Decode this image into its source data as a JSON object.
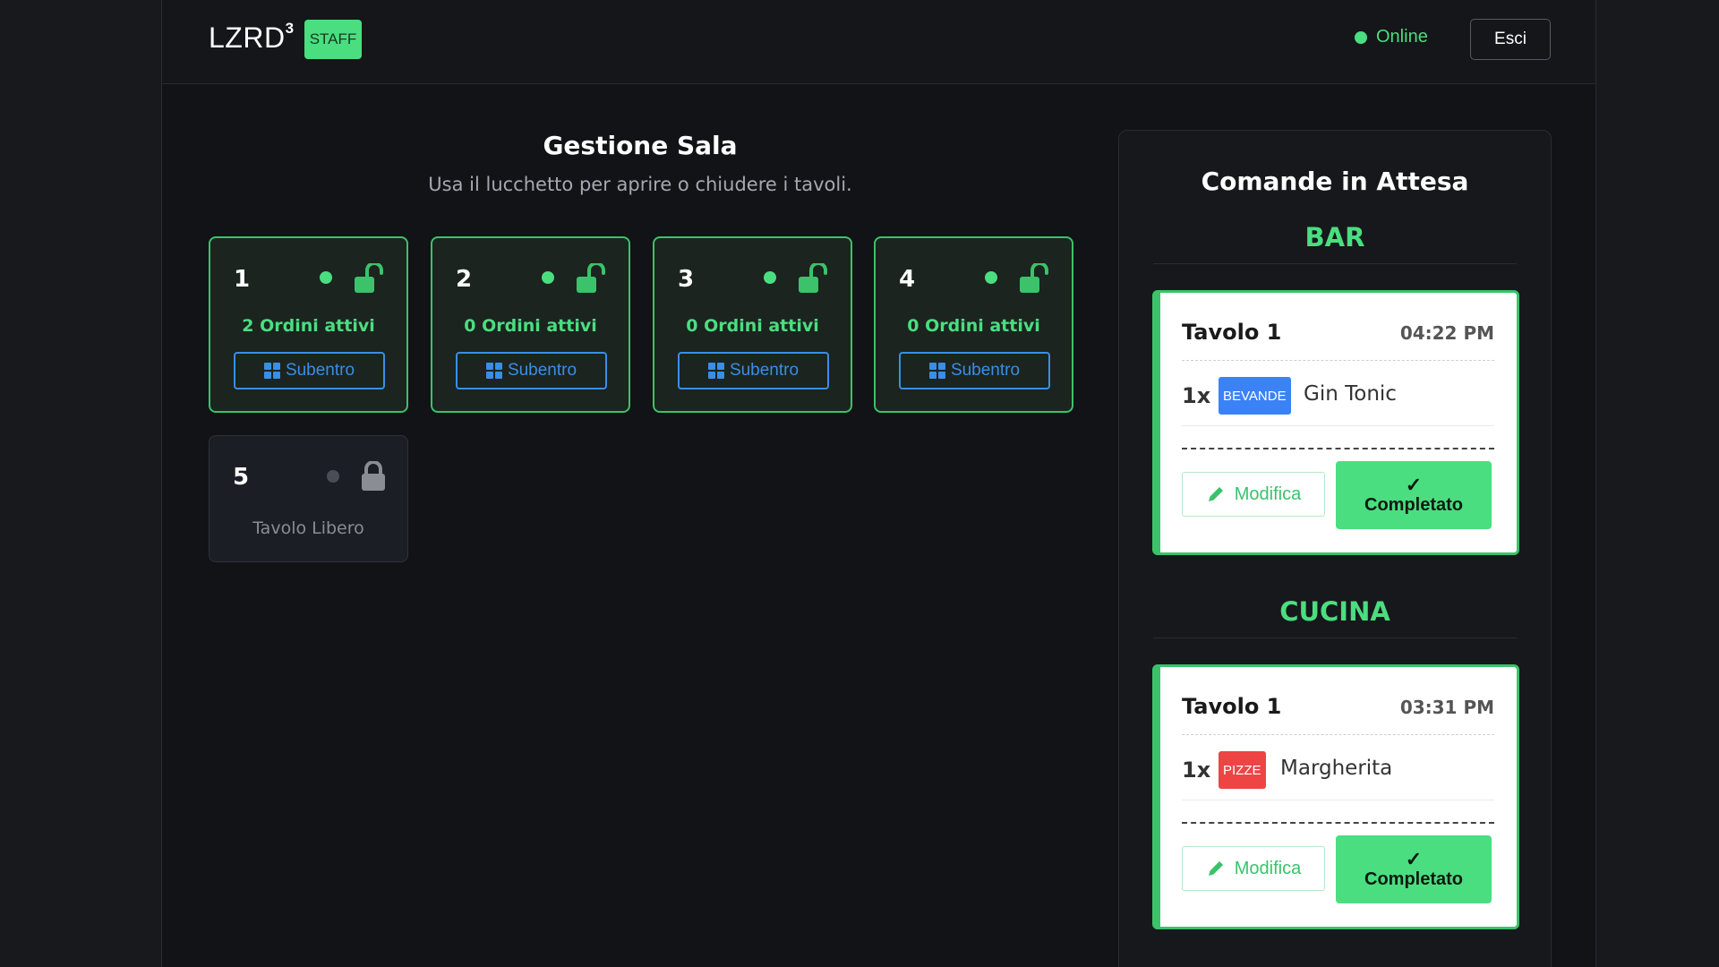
{
  "header": {
    "logo": "LZRD",
    "logo_sup": "3",
    "staff_badge": "STAFF",
    "status": "Online",
    "exit_label": "Esci"
  },
  "room": {
    "title": "Gestione Sala",
    "subtitle": "Usa il lucchetto per aprire o chiudere i tavoli.",
    "takeover_label": "Subentro",
    "tables": [
      {
        "number": "1",
        "orders": "2 Ordini attivi",
        "state": "open"
      },
      {
        "number": "2",
        "orders": "0 Ordini attivi",
        "state": "open"
      },
      {
        "number": "3",
        "orders": "0 Ordini attivi",
        "state": "open"
      },
      {
        "number": "4",
        "orders": "0 Ordini attivi",
        "state": "open"
      },
      {
        "number": "5",
        "orders": "Tavolo Libero",
        "state": "locked"
      }
    ]
  },
  "pending": {
    "title": "Comande in Attesa",
    "edit_label": "Modifica",
    "done_check": "✓",
    "done_label": "Completato",
    "sections": [
      {
        "name": "BAR",
        "order": {
          "table": "Tavolo 1",
          "time": "04:22 PM",
          "qty": "1x",
          "category": "BEVANDE",
          "category_color": "#3b82f6",
          "item": "Gin Tonic"
        }
      },
      {
        "name": "CUCINA",
        "order": {
          "table": "Tavolo 1",
          "time": "03:31 PM",
          "qty": "1x",
          "category": "PIZZE",
          "category_color": "#ef4444",
          "item": "Margherita"
        }
      }
    ]
  },
  "colors": {
    "accent": "#4ade80",
    "link_blue": "#3a8ee6",
    "background": "#121316"
  }
}
